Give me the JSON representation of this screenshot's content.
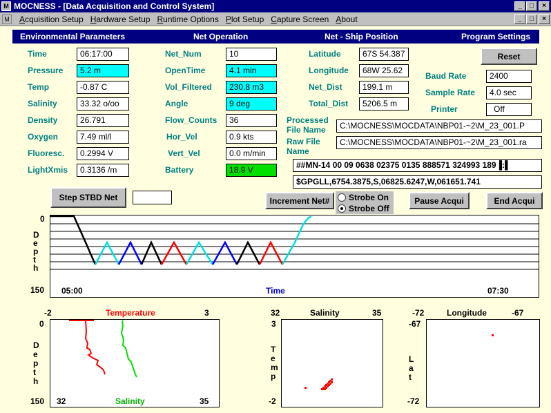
{
  "window": {
    "title": "MOCNESS - [Data Acquisition and Control System]",
    "app_icon": "window-icon",
    "controls": [
      "_",
      "□",
      "×"
    ]
  },
  "menu": [
    "Acquisition Setup",
    "Hardware Setup",
    "Runtime Options",
    "Plot Setup",
    "Capture Screen",
    "About"
  ],
  "headers": {
    "env": "Environmental Parameters",
    "net": "Net Operation",
    "pos": "Net - Ship Position",
    "prog": "Program Settings"
  },
  "env": [
    {
      "label": "Time",
      "value": "06:17:00",
      "color": "white"
    },
    {
      "label": "Pressure",
      "value": "5.2 m",
      "color": "cyan"
    },
    {
      "label": "Temp",
      "value": "-0.87 C",
      "color": "white"
    },
    {
      "label": "Salinity",
      "value": "33.32 o/oo",
      "color": "white"
    },
    {
      "label": "Density",
      "value": "26.791",
      "color": "white"
    },
    {
      "label": "Oxygen",
      "value": "7.49 ml/l",
      "color": "white"
    },
    {
      "label": "Fluoresc.",
      "value": "0.2994 V",
      "color": "white"
    },
    {
      "label": "LightXmis",
      "value": "0.3136 /m",
      "color": "white"
    }
  ],
  "net": [
    {
      "label": "Net_Num",
      "value": "10",
      "color": "white"
    },
    {
      "label": "OpenTime",
      "value": "4.1 min",
      "color": "cyan"
    },
    {
      "label": "Vol_Filtered",
      "value": "230.8 m3",
      "color": "cyan"
    },
    {
      "label": "Angle",
      "value": "9 deg",
      "color": "cyan"
    },
    {
      "label": "Flow_Counts",
      "value": "36",
      "color": "white"
    },
    {
      "label": "Hor_Vel",
      "value": "0.9 kts",
      "color": "white"
    },
    {
      "label": "Vert_Vel",
      "value": "0.0 m/min",
      "color": "white"
    },
    {
      "label": "Battery",
      "value": "18.9 V",
      "color": "green"
    }
  ],
  "pos": [
    {
      "label": "Latitude",
      "value": "67S 54.387"
    },
    {
      "label": "Longitude",
      "value": "68W 25.62"
    },
    {
      "label": "Net_Dist",
      "value": "199.1 m"
    },
    {
      "label": "Total_Dist",
      "value": "5206.5 m"
    }
  ],
  "prog": {
    "reset": "Reset",
    "baud_label": "Baud Rate",
    "baud": "2400",
    "sample_label": "Sample Rate",
    "sample": "4.0 sec",
    "printer_label": "Printer",
    "printer": "Off"
  },
  "files": {
    "processed_label": "Processed File Name",
    "processed": "C:\\MOCNESS\\MOCDATA\\NBP01-~2\\M_23_001.P",
    "raw_label": "Raw File Name",
    "raw": "C:\\MOCNESS\\MOCDATA\\NBP01-~2\\M_23_001.ra",
    "mn_string": "##MN-14 00 09 0638 02375 0135 888571 324993 189▐:▌",
    "gps_string": "$GPGLL,6754.3875,S,06825.6247,W,061651.741"
  },
  "controls": {
    "step": "Step STBD Net",
    "step_value": "",
    "increment": "Increment Net#",
    "strobe_on": "Strobe On",
    "strobe_off": "Strobe Off",
    "strobe_selected": "off",
    "pause": "Pause Acqui",
    "end": "End Acqui"
  },
  "depth_plot": {
    "ylabel": "Depth",
    "y_top": "0",
    "y_bottom": "150",
    "x_left": "05:00",
    "x_right": "07:30",
    "xlabel": "Time",
    "color_sequence": [
      "#000000",
      "#00E0E0",
      "#0000FF",
      "#000000",
      "#FF0000",
      "#00E0E0",
      "#0000FF",
      "#000000",
      "#FF0000"
    ]
  },
  "profile_plot": {
    "temp_title": "Temperature",
    "temp_min": "-2",
    "temp_max": "3",
    "sal_label": "Salinity",
    "sal_min": "32",
    "sal_max": "35",
    "ylabel": "Depth",
    "y_top": "0",
    "y_bottom": "150",
    "temp_color": "#FF0000",
    "sal_color": "#00E000"
  },
  "ts_plot": {
    "title": "Salinity",
    "x_min": "32",
    "x_max": "35",
    "ylabel": "Temp",
    "y_top": "3",
    "y_bottom": "-2"
  },
  "pos_plot": {
    "title": "Longitude",
    "x_min": "-72",
    "x_max": "-67",
    "ylabel": "Lat",
    "y_top": "-67",
    "y_bottom": "-72"
  }
}
